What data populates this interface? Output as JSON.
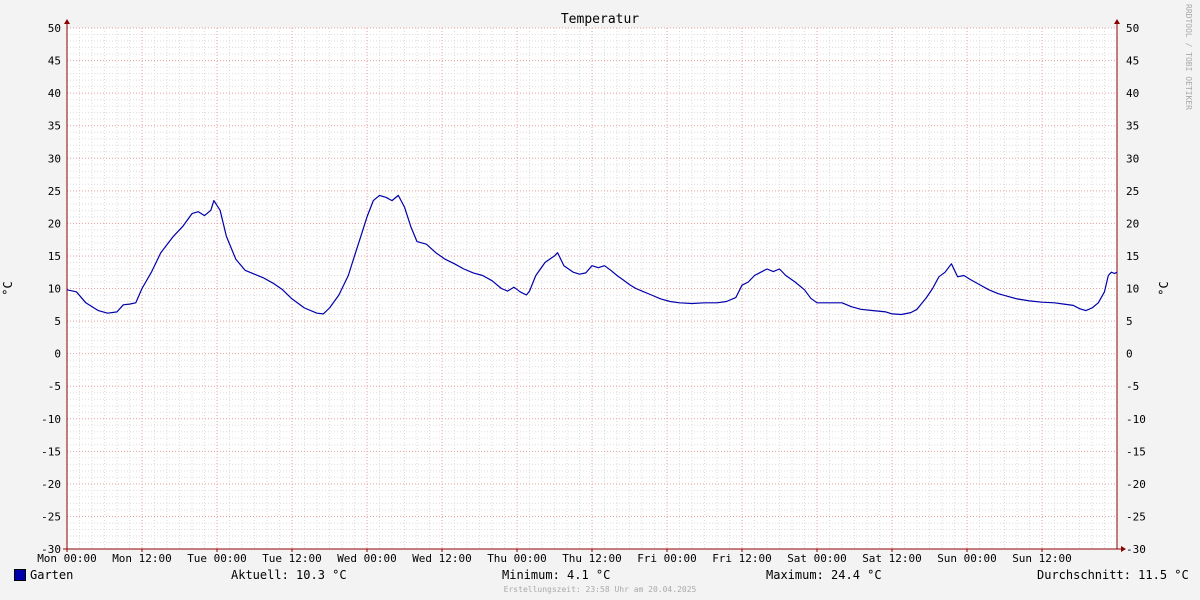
{
  "chart_data": {
    "type": "line",
    "title": "Temperatur",
    "ylabel": "°C",
    "ylim": [
      -30,
      50
    ],
    "yticks": [
      -30,
      -25,
      -20,
      -15,
      -10,
      -5,
      0,
      5,
      10,
      15,
      20,
      25,
      30,
      35,
      40,
      45,
      50
    ],
    "x_tick_labels": [
      "Mon 00:00",
      "Mon 12:00",
      "Tue 00:00",
      "Tue 12:00",
      "Wed 00:00",
      "Wed 12:00",
      "Thu 00:00",
      "Thu 12:00",
      "Fri 00:00",
      "Fri 12:00",
      "Sat 00:00",
      "Sat 12:00",
      "Sun 00:00",
      "Sun 12:00"
    ],
    "x_unit": "hours since Mon 00:00",
    "xlim": [
      0,
      168
    ],
    "grid": true,
    "series": [
      {
        "name": "Garten",
        "color": "#0000aa",
        "points": [
          [
            0,
            9.8
          ],
          [
            1.5,
            9.5
          ],
          [
            3,
            7.8
          ],
          [
            5,
            6.6
          ],
          [
            6.5,
            6.2
          ],
          [
            8,
            6.4
          ],
          [
            9,
            7.5
          ],
          [
            10,
            7.6
          ],
          [
            11,
            7.8
          ],
          [
            12,
            10
          ],
          [
            13.5,
            12.5
          ],
          [
            15,
            15.5
          ],
          [
            17,
            18
          ],
          [
            18.5,
            19.5
          ],
          [
            20,
            21.5
          ],
          [
            21,
            21.8
          ],
          [
            22,
            21.2
          ],
          [
            23,
            22
          ],
          [
            23.5,
            23.5
          ],
          [
            24.5,
            22
          ],
          [
            25.5,
            18
          ],
          [
            27,
            14.5
          ],
          [
            28.5,
            12.8
          ],
          [
            30,
            12.2
          ],
          [
            31.5,
            11.6
          ],
          [
            33,
            10.8
          ],
          [
            34.5,
            9.8
          ],
          [
            36,
            8.4
          ],
          [
            38,
            7
          ],
          [
            40,
            6.2
          ],
          [
            41,
            6.1
          ],
          [
            42,
            7
          ],
          [
            43.5,
            9
          ],
          [
            45,
            12
          ],
          [
            46,
            15
          ],
          [
            47,
            18
          ],
          [
            48,
            21
          ],
          [
            49,
            23.5
          ],
          [
            50,
            24.3
          ],
          [
            51,
            24
          ],
          [
            52,
            23.5
          ],
          [
            53,
            24.3
          ],
          [
            54,
            22.5
          ],
          [
            55,
            19.5
          ],
          [
            56,
            17.2
          ],
          [
            57.5,
            16.8
          ],
          [
            59,
            15.5
          ],
          [
            60.5,
            14.5
          ],
          [
            62,
            13.8
          ],
          [
            63.5,
            13
          ],
          [
            65,
            12.4
          ],
          [
            66.5,
            12
          ],
          [
            68,
            11.2
          ],
          [
            69.5,
            10
          ],
          [
            70.5,
            9.6
          ],
          [
            71.5,
            10.2
          ],
          [
            72.5,
            9.5
          ],
          [
            73.5,
            9
          ],
          [
            74,
            9.6
          ],
          [
            75,
            12
          ],
          [
            76.5,
            14
          ],
          [
            78,
            15
          ],
          [
            78.5,
            15.5
          ],
          [
            79.5,
            13.5
          ],
          [
            81,
            12.5
          ],
          [
            82,
            12.2
          ],
          [
            83,
            12.4
          ],
          [
            84,
            13.5
          ],
          [
            85,
            13.2
          ],
          [
            86,
            13.5
          ],
          [
            87,
            12.8
          ],
          [
            88,
            12
          ],
          [
            89,
            11.3
          ],
          [
            90,
            10.6
          ],
          [
            91,
            10
          ],
          [
            92,
            9.6
          ],
          [
            93.5,
            9
          ],
          [
            95,
            8.4
          ],
          [
            96.5,
            8
          ],
          [
            98,
            7.8
          ],
          [
            100,
            7.7
          ],
          [
            102,
            7.8
          ],
          [
            104,
            7.8
          ],
          [
            105.5,
            8
          ],
          [
            107,
            8.6
          ],
          [
            108,
            10.5
          ],
          [
            109,
            11
          ],
          [
            110,
            12
          ],
          [
            111,
            12.5
          ],
          [
            112,
            13
          ],
          [
            113,
            12.6
          ],
          [
            114,
            13
          ],
          [
            115,
            12
          ],
          [
            116.5,
            11
          ],
          [
            118,
            9.8
          ],
          [
            119,
            8.5
          ],
          [
            120,
            7.8
          ],
          [
            122,
            7.8
          ],
          [
            124,
            7.8
          ],
          [
            125.5,
            7.2
          ],
          [
            127,
            6.8
          ],
          [
            129,
            6.6
          ],
          [
            131,
            6.4
          ],
          [
            132,
            6.1
          ],
          [
            133.5,
            6
          ],
          [
            135,
            6.3
          ],
          [
            136,
            6.8
          ],
          [
            137.5,
            8.6
          ],
          [
            138.5,
            10
          ],
          [
            139.5,
            11.8
          ],
          [
            140.5,
            12.5
          ],
          [
            141.5,
            13.8
          ],
          [
            142.5,
            11.8
          ],
          [
            143.5,
            12
          ],
          [
            144.5,
            11.4
          ],
          [
            146,
            10.6
          ],
          [
            147.5,
            9.8
          ],
          [
            149,
            9.2
          ],
          [
            150.5,
            8.8
          ],
          [
            152,
            8.4
          ],
          [
            154,
            8.1
          ],
          [
            156,
            7.9
          ],
          [
            158,
            7.8
          ],
          [
            159.5,
            7.6
          ],
          [
            161,
            7.4
          ],
          [
            162,
            6.9
          ],
          [
            163,
            6.6
          ],
          [
            164,
            7
          ],
          [
            165,
            7.8
          ],
          [
            166,
            9.5
          ],
          [
            166.6,
            12
          ],
          [
            167.1,
            12.5
          ],
          [
            167.6,
            12.3
          ],
          [
            168,
            12.5
          ]
        ]
      }
    ],
    "legend": [
      {
        "name": "Garten",
        "color": "#0000aa"
      }
    ]
  },
  "stats": {
    "current": "Aktuell: 10.3 °C",
    "minimum": "Minimum: 4.1 °C",
    "maximum": "Maximum: 24.4 °C",
    "average": "Durchschnitt: 11.5 °C"
  },
  "credit": "Erstellungszeit: 23:58 Uhr am 20.04.2025",
  "watermark": "RRDTOOL / TOBI OETIKER",
  "colors": {
    "background": "#f3f3f3",
    "canvas": "#ffffff",
    "major_grid": "#e8a0a0",
    "minor_grid": "#dddddd",
    "axis": "#8b0000",
    "line": "#0000aa"
  }
}
